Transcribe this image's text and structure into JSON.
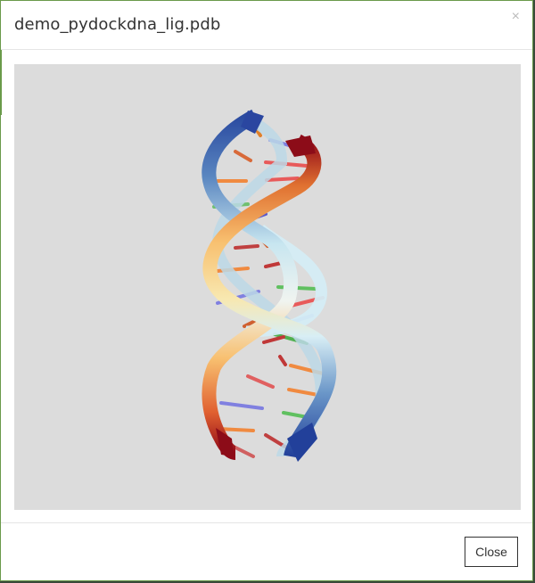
{
  "modal": {
    "title": "demo_pydockdna_lig.pdb",
    "close_icon": "×",
    "footer_close_label": "Close"
  },
  "viewer": {
    "background": "#dcdcdc",
    "content": "dna-double-helix-cartoon"
  },
  "colors": {
    "border_accent": "#6a9a4a",
    "strand_blue": "#2c4fa0",
    "strand_red": "#8b0f1a",
    "strand_orange": "#f09040",
    "strand_light": "#d8eef5"
  }
}
